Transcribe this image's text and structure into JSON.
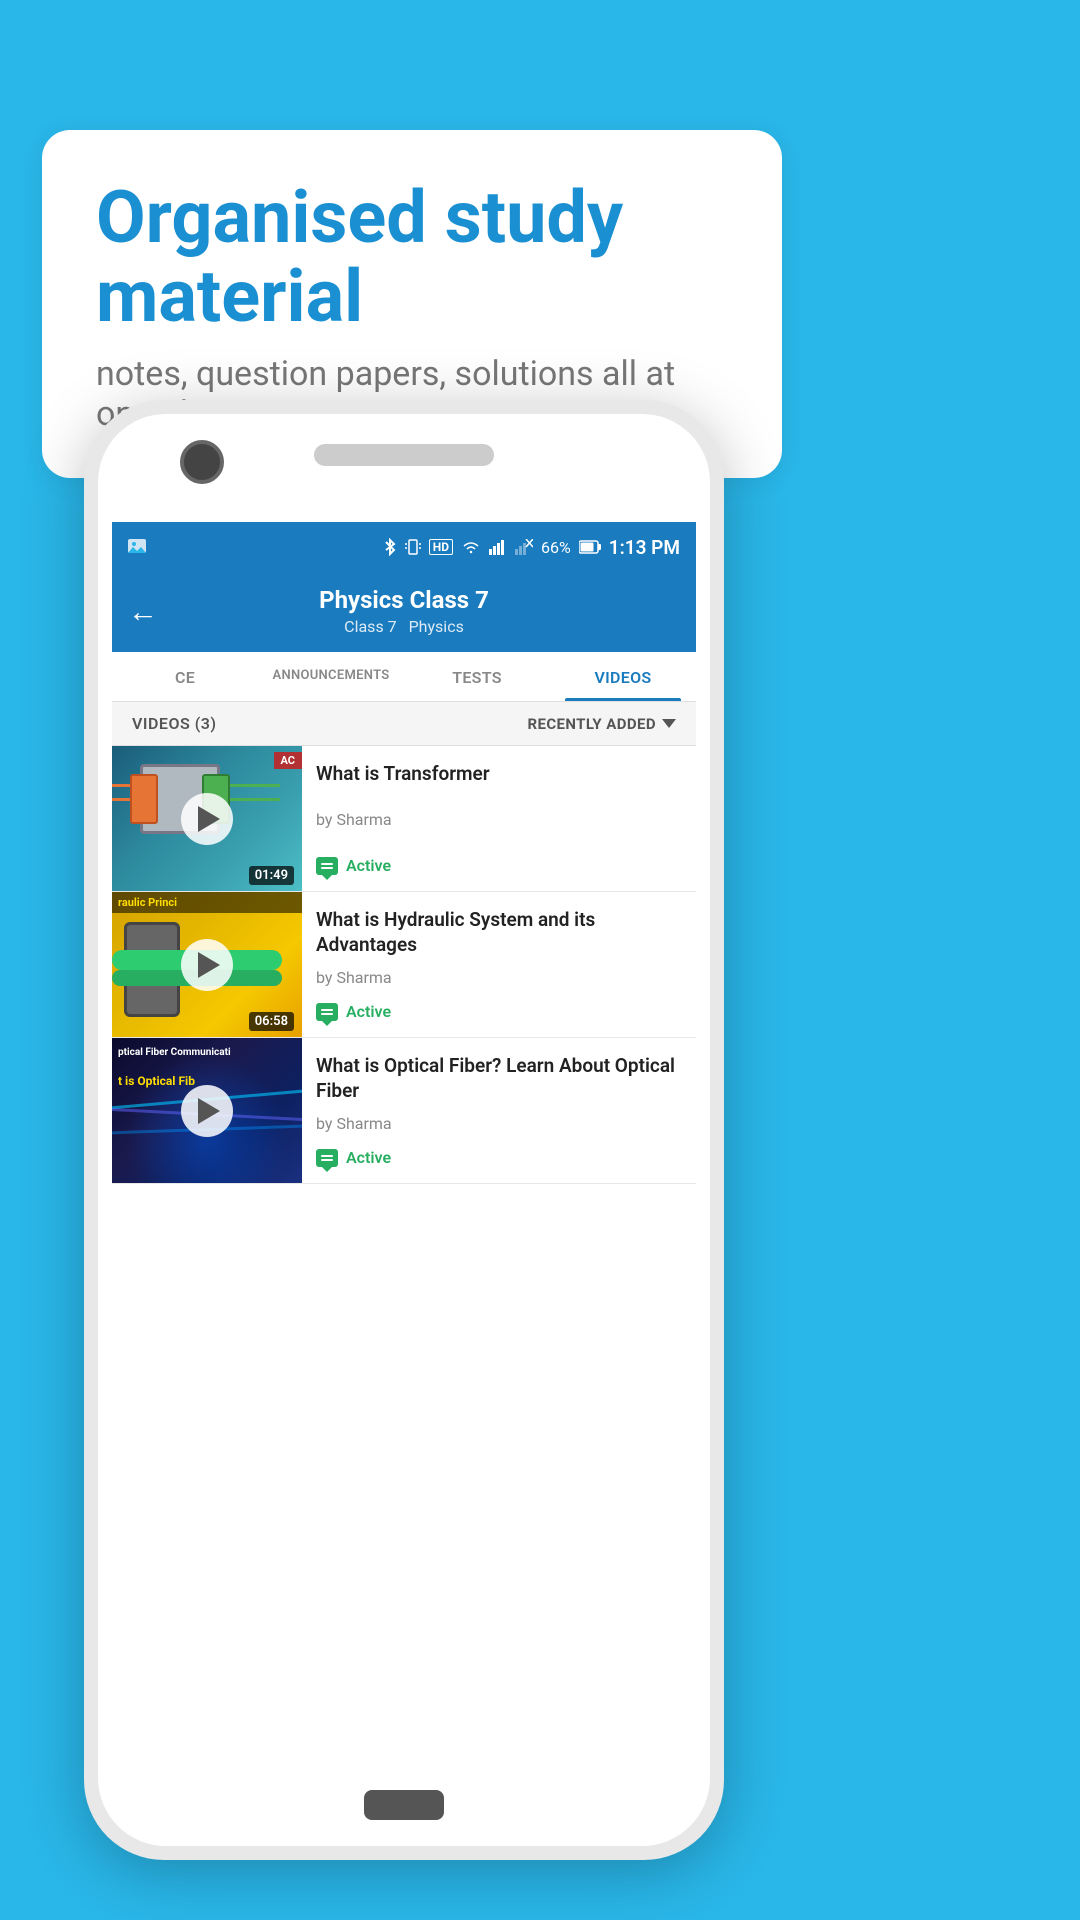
{
  "background_color": "#29b6e8",
  "bubble": {
    "title": "Organised study material",
    "subtitle": "notes, question papers, solutions all at one place"
  },
  "phone": {
    "status_bar": {
      "battery": "66%",
      "time": "1:13 PM",
      "signal_bars": "HD"
    },
    "header": {
      "back_icon": "←",
      "title": "Physics Class 7",
      "breadcrumb_class": "Class 7",
      "breadcrumb_sep": "  ",
      "breadcrumb_subject": "Physics"
    },
    "tabs": [
      {
        "id": "ce",
        "label": "CE",
        "active": false
      },
      {
        "id": "announcements",
        "label": "ANNOUNCEMENTS",
        "active": false
      },
      {
        "id": "tests",
        "label": "TESTS",
        "active": false
      },
      {
        "id": "videos",
        "label": "VIDEOS",
        "active": true
      }
    ],
    "videos_section": {
      "header_label": "VIDEOS (3)",
      "sort_label": "RECENTLY ADDED",
      "videos": [
        {
          "id": 1,
          "title": "What is  Transformer",
          "author": "by Sharma",
          "status": "Active",
          "duration": "01:49",
          "thumb_type": "transformer",
          "thumb_badge": "AC"
        },
        {
          "id": 2,
          "title": "What is Hydraulic System and its Advantages",
          "author": "by Sharma",
          "status": "Active",
          "duration": "06:58",
          "thumb_type": "hydraulic",
          "thumb_top_label": "raulic Princi",
          "thumb_text": ""
        },
        {
          "id": 3,
          "title": "What is Optical Fiber? Learn About Optical Fiber",
          "author": "by Sharma",
          "status": "Active",
          "duration": "",
          "thumb_type": "optical",
          "thumb_text_1": "ptical Fiber Communicati",
          "thumb_text_2": "is Optical Fib"
        }
      ]
    }
  }
}
